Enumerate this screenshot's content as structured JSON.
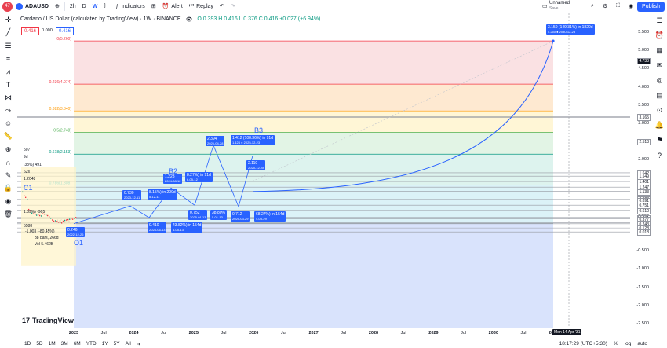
{
  "topbar": {
    "avatar": "47",
    "symbol": "ADAUSD",
    "timeframes": [
      "2h",
      "D",
      "W"
    ],
    "active_timeframe": "W",
    "indicators": "Indicators",
    "alert": "Alert",
    "replay": "Replay",
    "layout_name": "Unnamed",
    "layout_sub": "Save",
    "publish": "Publish"
  },
  "legend": {
    "title": "Cardano / US Dollar (calculated by TradingView) · 1W · BINANCE",
    "ohlc": "O 0.393 H 0.416 L 0.376 C 0.416 +0.027 (+6.94%)",
    "sell_price": "0.416",
    "spread": "0.000",
    "buy_price": "0.416"
  },
  "fib_levels": [
    {
      "label": "0(5.260)",
      "price": 5.26,
      "color": "#f23645"
    },
    {
      "label": "0.236(4.074)",
      "price": 4.074,
      "color": "#f23645"
    },
    {
      "label": "0.382(3.340)",
      "price": 3.34,
      "color": "#ff9800"
    },
    {
      "label": "0.5(2.748)",
      "price": 2.748,
      "color": "#4caf50"
    },
    {
      "label": "0.618(2.153)",
      "price": 2.153,
      "color": "#089981"
    },
    {
      "label": "0.786(1.308)",
      "price": 1.308,
      "color": "#00bcd4"
    },
    {
      "label": "1(0.246)",
      "price": 0.246,
      "color": "#787b86"
    }
  ],
  "annotations": {
    "target": "3.150 (149.31%) in 1820d",
    "target_sub": "5.260 ● 2030-12-23",
    "b3": "B3",
    "b2": "B2",
    "c1": "C1",
    "o1": "O1",
    "m1": "2.394",
    "m1_sub": "2025-04-28",
    "m2": "1.412 (108.36%) in 91d",
    "m2_sub": "1.124 ● 2025-12-23",
    "m3": "2.110",
    "m3_sub": "2025-12-28",
    "m4": "1.223",
    "m4_sub": "2024-08-12",
    "m5": "8.27%) in 91d",
    "m5_sub": "6-05-12",
    "m6": "0.730",
    "m6_sub": "2023-12-11",
    "m7": "8.15%) in 200d",
    "m7_sub": "5-12-11",
    "m8": "0.410",
    "m8_sub": "2024-06-13",
    "m9": "43.82%) in 154d",
    "m9_sub": "4-05-13",
    "m10": "0.752",
    "m10_sub": "2025-01-13",
    "m11": "38.80%",
    "m11_sub": "5-01-13",
    "m12": "0.712",
    "m12_sub": "2025-03-29",
    "m13": "68.27%) in 154d",
    "m13_sub": "4-05-29",
    "left_stats": [
      "-1.003 (-80.45%)",
      "38 bars, 266d",
      "Vol 5.462B"
    ],
    "left_tag1": "0.246",
    "left_tag1_sub": "2022-12-26",
    "left_values": [
      "507",
      "9d",
      ".38%) 491",
      "62s",
      "1.2048",
      "1.39%) -905",
      "5588"
    ],
    "cursor_date": "Mon 14 Apr '31"
  },
  "y_axis": [
    "5.500",
    "5.000",
    "4.500",
    "4.000",
    "3.500",
    "3.000",
    "2.500",
    "2.000",
    "1.500",
    "1.000",
    "0.500",
    "-0.500",
    "-1.000",
    "-1.500",
    "-2.000",
    "-2.500"
  ],
  "y_axis_tags": [
    "4.733",
    "3.184",
    "3.165",
    "2.513",
    "1.642",
    "1.549",
    "1.401",
    "1.247",
    "1.133",
    "0.923",
    "0.891",
    "0.751",
    "0.610",
    "0.416",
    "0.411",
    "0.377",
    "0.267",
    "0.243",
    "0.128",
    "0.018"
  ],
  "x_axis": [
    "2023",
    "Jul",
    "2024",
    "Jul",
    "2025",
    "Jul",
    "2026",
    "Jul",
    "2027",
    "Jul",
    "2028",
    "Jul",
    "2029",
    "Jul",
    "2030",
    "Jul",
    "2032"
  ],
  "bottombar": {
    "ranges": [
      "1D",
      "5D",
      "1M",
      "3M",
      "6M",
      "YTD",
      "1Y",
      "5Y",
      "All"
    ],
    "clock": "18:17:29 (UTC+5:30)",
    "pct": "%",
    "log": "log",
    "auto": "auto"
  },
  "brand": "TradingView",
  "colors": {
    "accent": "#2962ff",
    "up": "#089981",
    "down": "#f23645"
  }
}
